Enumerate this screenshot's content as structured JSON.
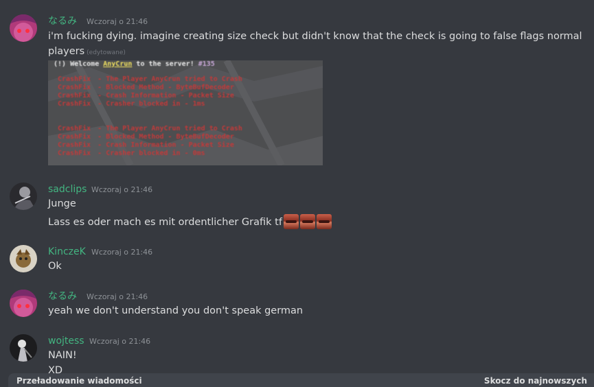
{
  "messages": [
    {
      "username": "なるみ",
      "username_color": "#43b581",
      "timestamp": "Wczoraj o 21:46",
      "lines": [
        "i'm fucking dying. imagine creating size check but didn't know that the check is going to false flags normal",
        "players"
      ],
      "edited": "(edytowane)",
      "attachment": {
        "header": {
          "prefix": "(!) Welcome ",
          "name": "AnyCrun",
          "suffix": " to the server! ",
          "tag": "#135"
        },
        "blocks": [
          [
            [
              "CrashFix",
              "- The Player AnyCrun tried to Crash"
            ],
            [
              "CrashFix",
              "- Blocked Method - ByteBufDecoder"
            ],
            [
              "CrashFix",
              "- Crash Information - Packet Size"
            ],
            [
              "CrashFix",
              "- Crasher blocked in - 1ms"
            ]
          ],
          [
            [
              "CrashFix",
              "- The Player AnyCrun tried to Crash"
            ],
            [
              "CrashFix",
              "- Blocked Method - ByteBufDecoder"
            ],
            [
              "CrashFix",
              "- Crash Information - Packet Size"
            ],
            [
              "CrashFix",
              "- Crasher blocked in - 0ms"
            ]
          ]
        ]
      }
    },
    {
      "username": "sadclips",
      "username_color": "#43b581",
      "timestamp": "Wczoraj o 21:46",
      "lines": [
        "Junge",
        "Lass es oder mach es mit ordentlicher Grafik tf"
      ],
      "emoji_count": 3
    },
    {
      "username": "KinczeK",
      "username_color": "#43b581",
      "timestamp": "Wczoraj o 21:46",
      "lines": [
        "Ok"
      ]
    },
    {
      "username": "なるみ",
      "username_color": "#43b581",
      "timestamp": "Wczoraj o 21:46",
      "lines": [
        "yeah we don't understand you don't speak german"
      ]
    },
    {
      "username": "wojtess",
      "username_color": "#43b581",
      "timestamp": "Wczoraj o 21:46",
      "lines": [
        "NAIN!",
        "XD"
      ]
    }
  ],
  "bottom_bar": {
    "left": "Przeładowanie wiadomości",
    "right": "Skocz do najnowszych"
  }
}
